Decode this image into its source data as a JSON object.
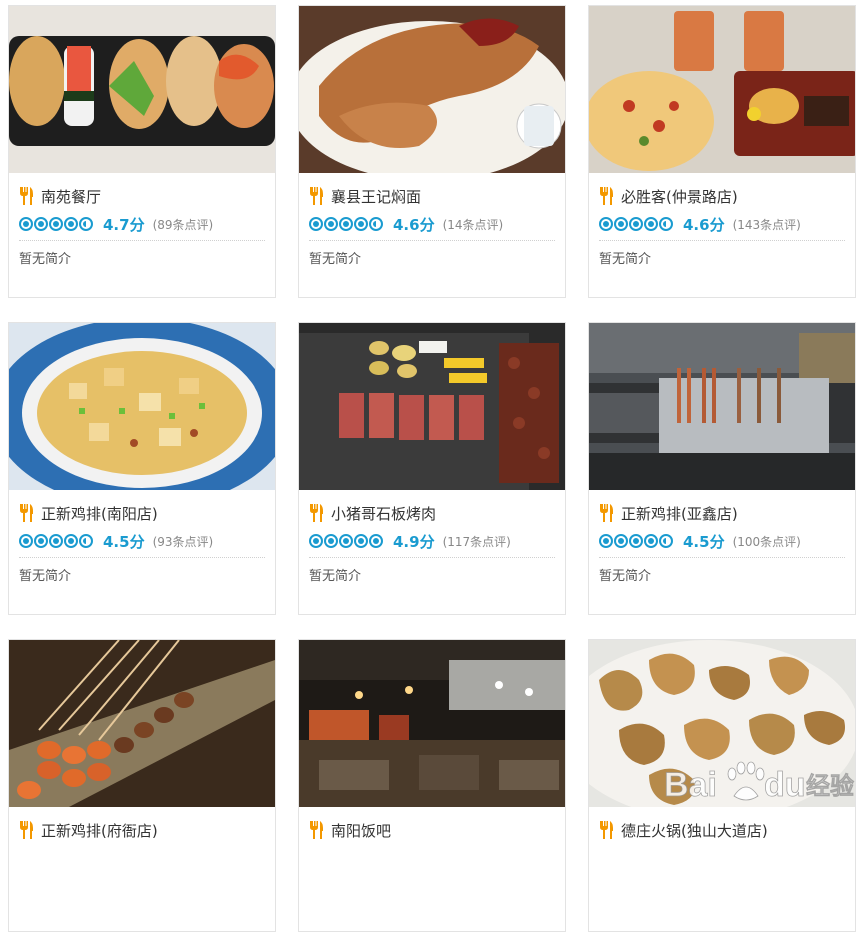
{
  "colors": {
    "accent": "#1a9bd0",
    "fork_icon": "#f39800"
  },
  "cards": [
    {
      "name": "南苑餐厅",
      "score": "4.7分",
      "reviews": "(89条点评)",
      "desc": "暂无简介"
    },
    {
      "name": "襄县王记焖面",
      "score": "4.6分",
      "reviews": "(14条点评)",
      "desc": "暂无简介"
    },
    {
      "name": "必胜客(仲景路店)",
      "score": "4.6分",
      "reviews": "(143条点评)",
      "desc": "暂无简介"
    },
    {
      "name": "正新鸡排(南阳店)",
      "score": "4.5分",
      "reviews": "(93条点评)",
      "desc": "暂无简介"
    },
    {
      "name": "小猪哥石板烤肉",
      "score": "4.9分",
      "reviews": "(117条点评)",
      "desc": "暂无简介"
    },
    {
      "name": "正新鸡排(亚鑫店)",
      "score": "4.5分",
      "reviews": "(100条点评)",
      "desc": "暂无简介"
    },
    {
      "name": "正新鸡排(府衙店)",
      "score": "",
      "reviews": "",
      "desc": ""
    },
    {
      "name": "南阳饭吧",
      "score": "",
      "reviews": "",
      "desc": ""
    },
    {
      "name": "德庄火锅(独山大道店)",
      "score": "",
      "reviews": "",
      "desc": ""
    }
  ],
  "watermark": {
    "brand": "Bai du",
    "suffix": "经验"
  }
}
